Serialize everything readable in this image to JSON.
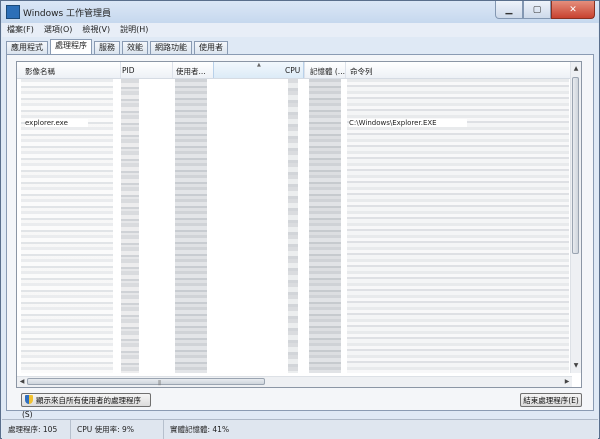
{
  "window": {
    "title": "Windows 工作管理員"
  },
  "menu": [
    "檔案(F)",
    "選項(O)",
    "檢視(V)",
    "說明(H)"
  ],
  "tabs": [
    "應用程式",
    "處理程序",
    "服務",
    "效能",
    "網路功能",
    "使用者"
  ],
  "active_tab": "處理程序",
  "columns": [
    "影像名稱",
    "PID",
    "使用者...",
    "CPU",
    "記憶體 (...",
    "命令列"
  ],
  "sorted_column": "CPU",
  "visible_row": {
    "image_name": "explorer.exe",
    "command_line": "C:\\Windows\\Explorer.EXE"
  },
  "buttons": {
    "show_all": "顯示來自所有使用者的處理程序(S)",
    "end_process": "結束處理程序(E)"
  },
  "status": {
    "processes": "處理程序: 105",
    "cpu": "CPU 使用率: 9%",
    "memory": "實體記憶體: 41%"
  },
  "colors": {
    "title_bar": "#c9dbf0",
    "close_button": "#c84230",
    "selected_column": "#dcebf7"
  }
}
